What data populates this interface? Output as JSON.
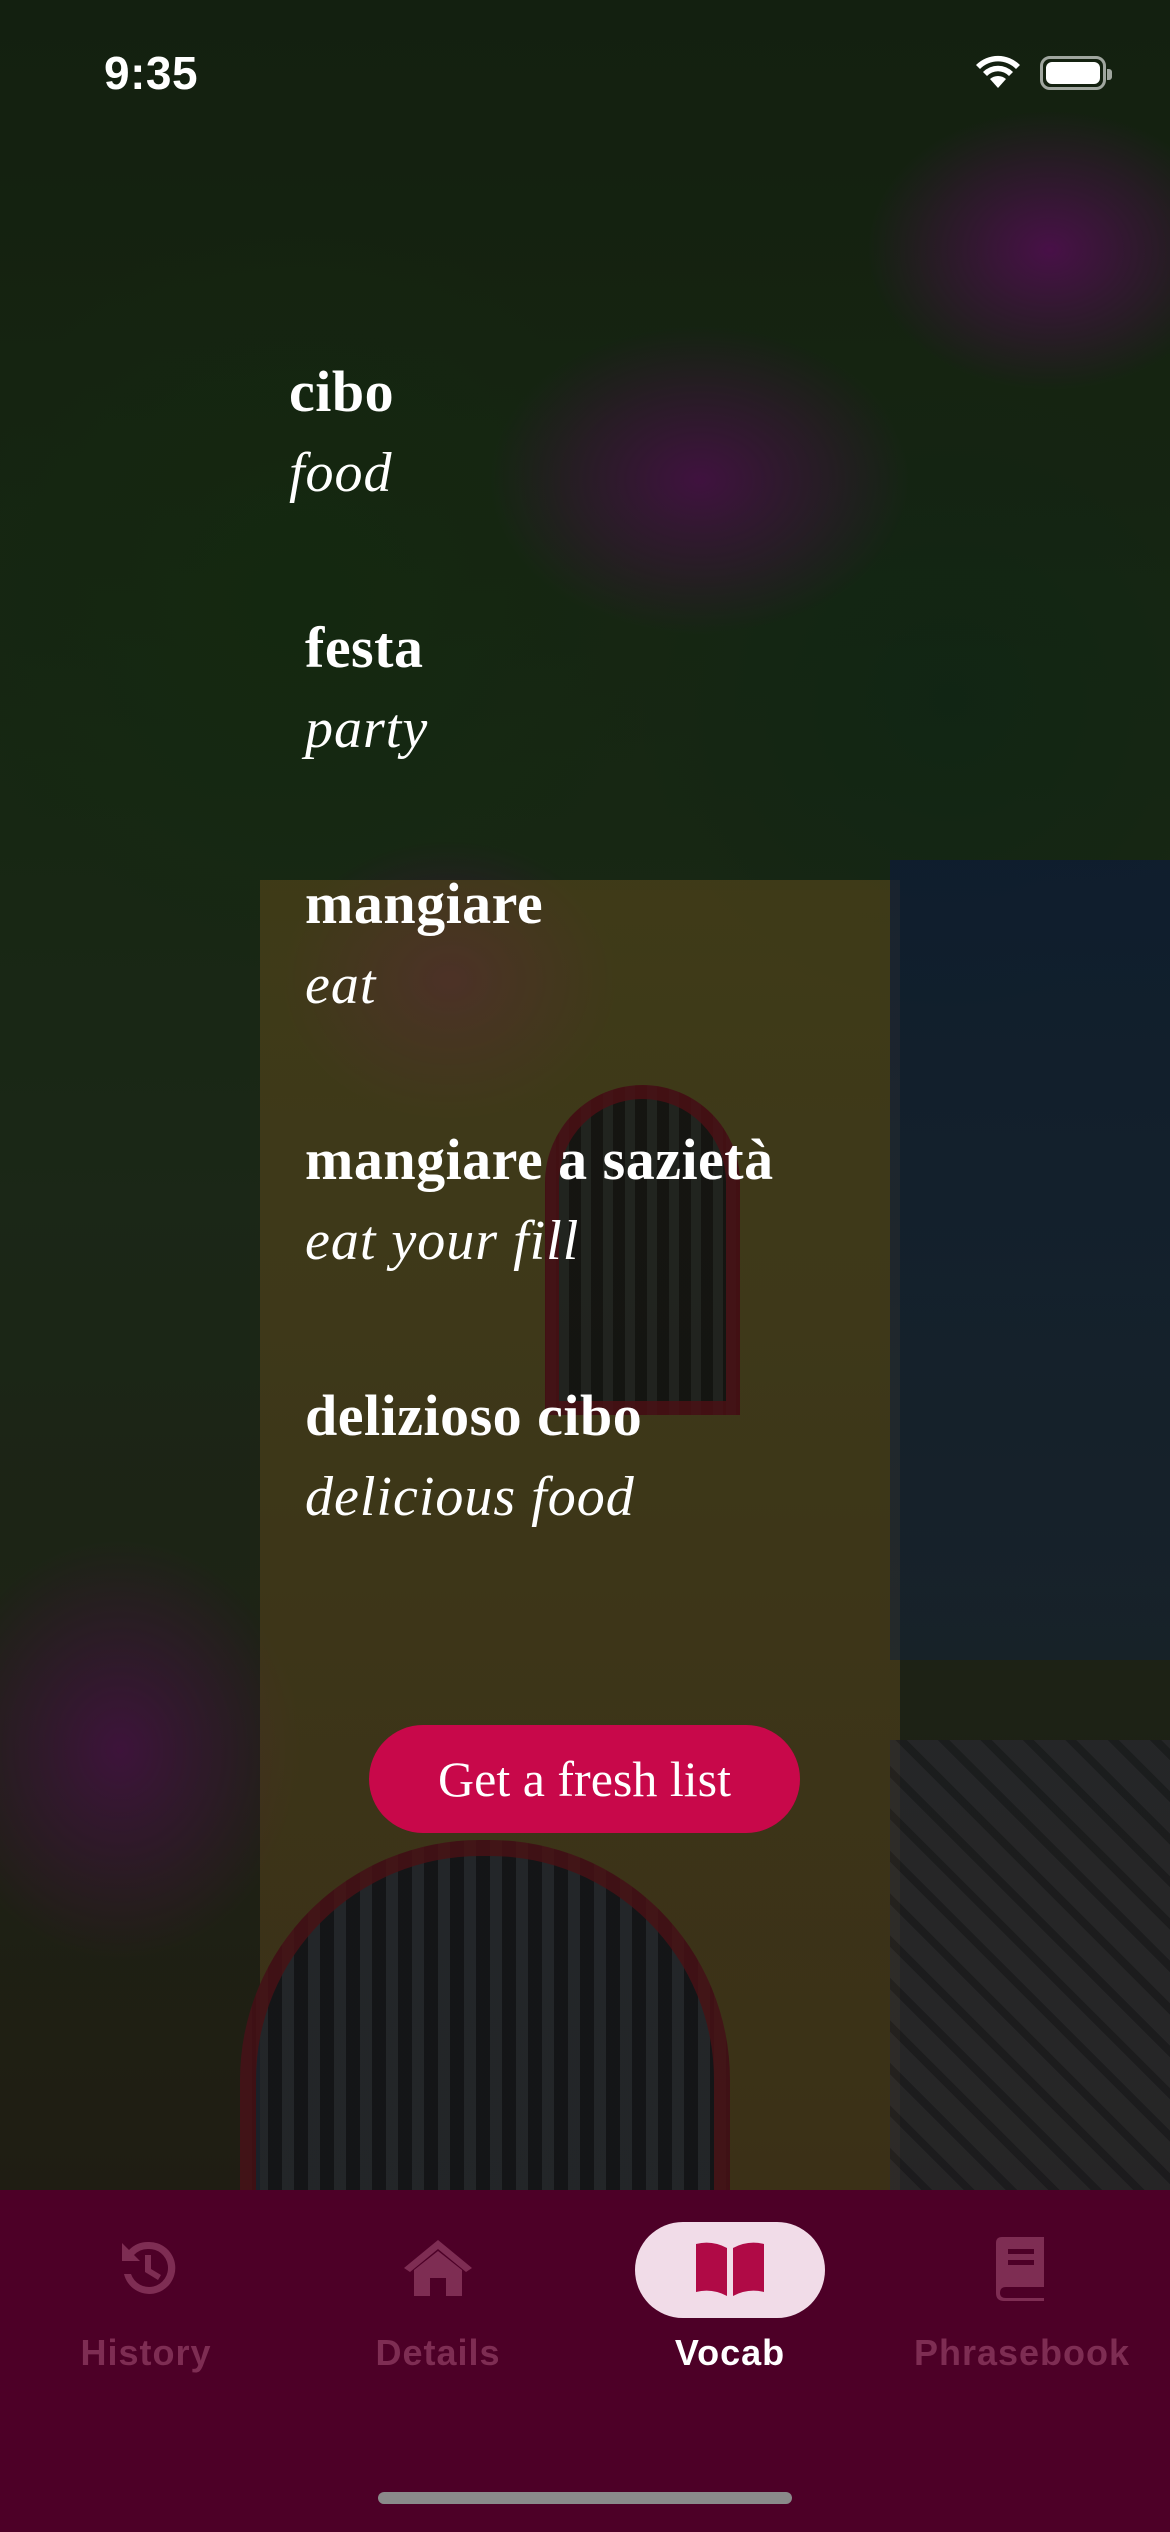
{
  "status_bar": {
    "time": "9:35",
    "wifi_icon": "wifi-icon",
    "battery_icon": "battery-icon"
  },
  "vocab": {
    "items": [
      {
        "word": "cibo",
        "translation": "food"
      },
      {
        "word": "festa",
        "translation": "party"
      },
      {
        "word": "mangiare",
        "translation": "eat"
      },
      {
        "word": "mangiare a sazietà",
        "translation": "eat your fill"
      },
      {
        "word": "delizioso cibo",
        "translation": "delicious food"
      }
    ]
  },
  "fresh_button": {
    "label": "Get a fresh list"
  },
  "tabs": [
    {
      "label": "History",
      "icon": "history-icon",
      "active": false
    },
    {
      "label": "Details",
      "icon": "home-icon",
      "active": false
    },
    {
      "label": "Vocab",
      "icon": "open-book-icon",
      "active": true
    },
    {
      "label": "Phrasebook",
      "icon": "book-icon",
      "active": false
    }
  ],
  "colors": {
    "accent_button": "#c8084a",
    "tab_bar_background": "#4d0027",
    "active_tab_pill": "#f1dce8",
    "inactive_tab": "#7e2d53"
  }
}
